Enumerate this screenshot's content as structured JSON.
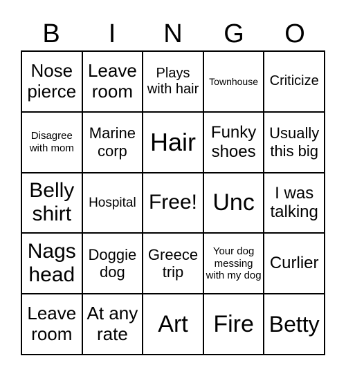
{
  "header": [
    "B",
    "I",
    "N",
    "G",
    "O"
  ],
  "cells": [
    "Nose pierce",
    "Leave room",
    "Plays with hair",
    "Townhouse",
    "Criticize",
    "Disagree with mom",
    "Marine corp",
    "Hair",
    "Funky shoes",
    "Usually this big",
    "Belly shirt",
    "Hospital",
    "Free!",
    "Unc",
    "I was talking",
    "Nags head",
    "Doggie dog",
    "Greece trip",
    "Your dog messing with my dog",
    "Curlier",
    "Leave room",
    "At any rate",
    "Art",
    "Fire",
    "Betty"
  ]
}
